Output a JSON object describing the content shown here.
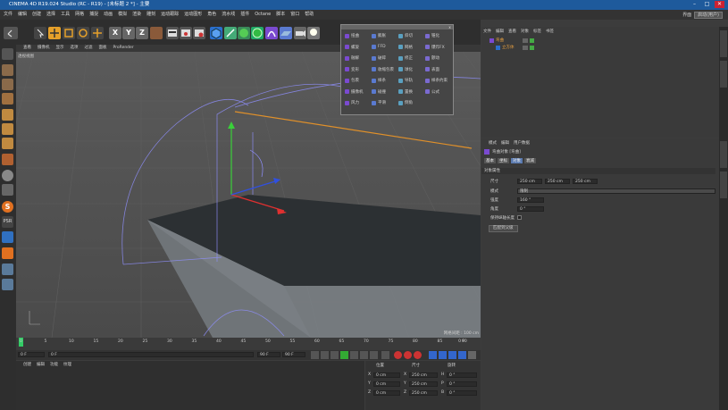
{
  "window": {
    "title": "CINEMA 4D R19.024 Studio (RC - R19) - [未标题 2 *] - 主要"
  },
  "menubar": {
    "items": [
      "文件",
      "编辑",
      "创建",
      "选择",
      "工具",
      "网格",
      "捕捉",
      "动画",
      "模拟",
      "渲染",
      "雕刻",
      "运动跟踪",
      "运动图形",
      "角色",
      "流水线",
      "插件",
      "Octane",
      "脚本",
      "窗口",
      "帮助"
    ],
    "layout_label": "界面",
    "layout_value": "启动(用户)"
  },
  "viewport": {
    "menu": [
      "查看",
      "摄像机",
      "显示",
      "选项",
      "过滤",
      "面板",
      "ProRender"
    ],
    "label": "透视视图",
    "grid_spacing": "网格间距 : 100 cm"
  },
  "popup": {
    "items": [
      [
        "扭曲",
        "膨胀",
        "斜切",
        "锥化"
      ],
      [
        "螺旋",
        "FFD",
        "网格",
        "爆炸FX"
      ],
      [
        "融解",
        "破碎",
        "修正",
        "颤动"
      ],
      [
        "变形",
        "收缩包裹",
        "球化",
        "表面"
      ],
      [
        "包裹",
        "样条",
        "导轨",
        "样条约束"
      ],
      [
        "摄像机",
        "碰撞",
        "置换",
        "公式"
      ],
      [
        "风力",
        "平滑",
        "倒角"
      ]
    ]
  },
  "timeline": {
    "ticks": [
      "0",
      "5",
      "10",
      "15",
      "20",
      "25",
      "30",
      "35",
      "40",
      "45",
      "50",
      "55",
      "60",
      "65",
      "70",
      "75",
      "80",
      "85",
      "90"
    ],
    "end_label": "0 F"
  },
  "transport": {
    "start": "0 F",
    "cur": "0 F",
    "end": "90 F",
    "max": "90 F"
  },
  "materials": {
    "menu": [
      "创建",
      "编辑",
      "功能",
      "纹理"
    ]
  },
  "coords": {
    "headers": [
      "位置",
      "尺寸",
      "旋转"
    ],
    "rows": [
      {
        "axis": "X",
        "pos": "0 cm",
        "size": "250 cm",
        "rot_label": "H",
        "rot": "0 °"
      },
      {
        "axis": "Y",
        "pos": "0 cm",
        "size": "250 cm",
        "rot_label": "P",
        "rot": "0 °"
      },
      {
        "axis": "Z",
        "pos": "0 cm",
        "size": "250 cm",
        "rot_label": "B",
        "rot": "0 °"
      }
    ]
  },
  "objects": {
    "menu": [
      "文件",
      "编辑",
      "查看",
      "对象",
      "标签",
      "书签"
    ],
    "items": [
      {
        "name": "弯曲"
      },
      {
        "name": "立方体"
      }
    ]
  },
  "attributes": {
    "menu": [
      "模式",
      "编辑",
      "用户数据"
    ],
    "title": "弯曲对象 [弯曲]",
    "tabs": [
      "基本",
      "坐标",
      "对象",
      "衰减"
    ],
    "section": "对象属性",
    "size_label": "尺寸",
    "size": [
      "250 cm",
      "250 cm",
      "250 cm"
    ],
    "mode_label": "模式",
    "mode_value": "限制",
    "strength_label": "强度",
    "strength": "160 °",
    "angle_label": "角度",
    "angle": "0 °",
    "keep_length_label": "保持纵轴长度",
    "fit_button": "匹配到父级"
  },
  "colors": {
    "accent": "#1e5a9c",
    "panel": "#3a3a3a",
    "viewport": "#4a4a4a"
  }
}
